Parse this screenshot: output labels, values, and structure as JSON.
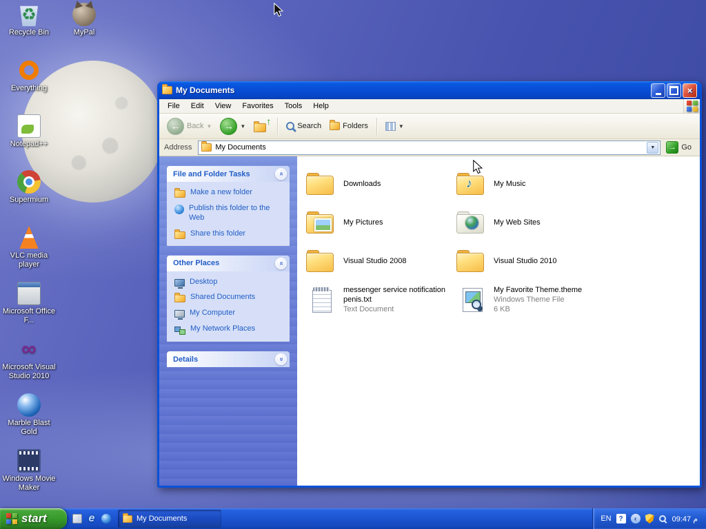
{
  "desktop": {
    "icons": [
      {
        "label": "Recycle Bin",
        "icon": "ic-recycle"
      },
      {
        "label": "Everything",
        "icon": "ic-everything"
      },
      {
        "label": "Notepad++",
        "icon": "ic-npp"
      },
      {
        "label": "Supermium",
        "icon": "ic-supermium"
      },
      {
        "label": "VLC media player",
        "icon": "ic-vlc"
      },
      {
        "label": "Microsoft Office F...",
        "icon": "ic-office"
      },
      {
        "label": "Microsoft Visual Studio 2010",
        "icon": "ic-vs"
      },
      {
        "label": "Marble Blast Gold",
        "icon": "ic-marble"
      },
      {
        "label": "Windows Movie Maker",
        "icon": "ic-wmm"
      },
      {
        "label": "MyPal",
        "icon": "ic-mypal"
      }
    ]
  },
  "window": {
    "title": "My Documents",
    "menu_items": [
      "File",
      "Edit",
      "View",
      "Favorites",
      "Tools",
      "Help"
    ],
    "toolbar": {
      "back_label": "Back",
      "search_label": "Search",
      "folders_label": "Folders"
    },
    "address": {
      "label": "Address",
      "value": "My Documents",
      "go_label": "Go"
    },
    "task_sections": {
      "file_tasks": {
        "title": "File and Folder Tasks",
        "items": [
          {
            "label": "Make a new folder",
            "icon": "tic-newfolder"
          },
          {
            "label": "Publish this folder to the Web",
            "icon": "tic-publish"
          },
          {
            "label": "Share this folder",
            "icon": "tic-share"
          }
        ]
      },
      "other_places": {
        "title": "Other Places",
        "items": [
          {
            "label": "Desktop",
            "icon": "tic-desktop"
          },
          {
            "label": "Shared Documents",
            "icon": "tic-shareddocs"
          },
          {
            "label": "My Computer",
            "icon": "tic-computer"
          },
          {
            "label": "My Network Places",
            "icon": "tic-network"
          }
        ]
      },
      "details": {
        "title": "Details"
      }
    },
    "files": [
      {
        "name": "Downloads",
        "type": "fi-folder"
      },
      {
        "name": "My Music",
        "type": "fi-music"
      },
      {
        "name": "My Pictures",
        "type": "fi-pictures"
      },
      {
        "name": "My Web Sites",
        "type": "fi-web"
      },
      {
        "name": "Visual Studio 2008",
        "type": "fi-folder"
      },
      {
        "name": "Visual Studio 2010",
        "type": "fi-folder"
      },
      {
        "name": "messenger service notification penis.txt",
        "type": "fi-text",
        "meta": "Text Document"
      },
      {
        "name": "My Favorite Theme.theme",
        "type": "fi-theme",
        "meta": "Windows Theme File",
        "meta2": "6 KB"
      }
    ]
  },
  "taskbar": {
    "start_label": "start",
    "buttons": [
      {
        "label": "My Documents"
      }
    ],
    "quick_launch": [
      {
        "icon": "ql-desktop"
      },
      {
        "icon": "ql-e"
      },
      {
        "icon": "ql-globe"
      }
    ],
    "tray": {
      "lang": "EN",
      "time": "09:47 م"
    }
  },
  "colors": {
    "titlebar_blue": "#0850d6",
    "taskpane_blue": "#6a7fd8",
    "section_link_blue": "#215dc6",
    "taskbar_blue": "#1d55d2",
    "start_green": "#379a2b",
    "close_red": "#de5540"
  }
}
